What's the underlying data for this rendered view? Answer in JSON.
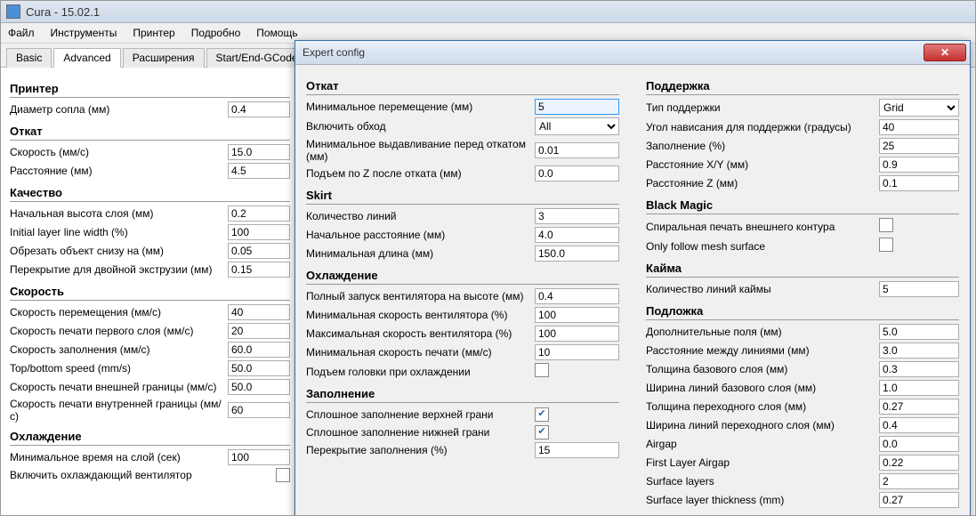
{
  "window": {
    "title": "Cura - 15.02.1"
  },
  "menu": {
    "file": "Файл",
    "tools": "Инструменты",
    "printer": "Принтер",
    "details": "Подробно",
    "help": "Помощь"
  },
  "tabs": {
    "basic": "Basic",
    "advanced": "Advanced",
    "extensions": "Расширения",
    "startend": "Start/End-GCode"
  },
  "left": {
    "printer_h": "Принтер",
    "nozzle_d": "Диаметр сопла (мм)",
    "nozzle_d_v": "0.4",
    "retract_h": "Откат",
    "speed": "Скорость (мм/с)",
    "speed_v": "15.0",
    "dist": "Расстояние (мм)",
    "dist_v": "4.5",
    "quality_h": "Качество",
    "init_layer_h": "Начальная высота слоя (мм)",
    "init_layer_h_v": "0.2",
    "init_line_w": "Initial layer line width (%)",
    "init_line_w_v": "100",
    "cut_bottom": "Обрезать объект снизу на (мм)",
    "cut_bottom_v": "0.05",
    "dual_overlap": "Перекрытие для двойной экструзии (мм)",
    "dual_overlap_v": "0.15",
    "speed_h": "Скорость",
    "travel_sp": "Скорость перемещения (мм/с)",
    "travel_sp_v": "40",
    "first_sp": "Скорость печати первого слоя (мм/с)",
    "first_sp_v": "20",
    "infill_sp": "Скорость заполнения (мм/с)",
    "infill_sp_v": "60.0",
    "tb_sp": "Top/bottom speed (mm/s)",
    "tb_sp_v": "50.0",
    "outer_sp": "Скорость печати внешней границы (мм/с)",
    "outer_sp_v": "50.0",
    "inner_sp": "Скорость печати внутренней границы (мм/с)",
    "inner_sp_v": "60",
    "cool_h": "Охлаждение",
    "min_layer_t": "Минимальное время на слой (сек)",
    "min_layer_t_v": "100",
    "fan_enable": "Включить охлаждающий вентилятор"
  },
  "dlg": {
    "title": "Expert config",
    "retract_h": "Откат",
    "min_travel": "Минимальное перемещение (мм)",
    "min_travel_v": "5",
    "combing": "Включить обход",
    "combing_v": "All",
    "min_ext": "Минимальное выдавливание перед откатом (мм)",
    "min_ext_v": "0.01",
    "z_hop": "Подъем по Z после отката (мм)",
    "z_hop_v": "0.0",
    "skirt_h": "Skirt",
    "line_cnt": "Количество линий",
    "line_cnt_v": "3",
    "start_dist": "Начальное расстояние (мм)",
    "start_dist_v": "4.0",
    "min_len": "Минимальная длина (мм)",
    "min_len_v": "150.0",
    "cool_h": "Охлаждение",
    "fan_full": "Полный запуск вентилятора на высоте (мм)",
    "fan_full_v": "0.4",
    "fan_min": "Минимальная скорость вентилятора (%)",
    "fan_min_v": "100",
    "fan_max": "Максимальная скорость вентилятора (%)",
    "fan_max_v": "100",
    "min_sp": "Минимальная скорость печати (мм/с)",
    "min_sp_v": "10",
    "head_lift": "Подъем головки при охлаждении",
    "infill_h": "Заполнение",
    "solid_top": "Сплошное заполнение верхней грани",
    "solid_bot": "Сплошное заполнение нижней грани",
    "infill_ov": "Перекрытие заполнения (%)",
    "infill_ov_v": "15",
    "support_h": "Поддержка",
    "sup_type": "Тип поддержки",
    "sup_type_v": "Grid",
    "sup_angle": "Угол нависания для поддержки (градусы)",
    "sup_angle_v": "40",
    "sup_fill": "Заполнение (%)",
    "sup_fill_v": "25",
    "sup_xy": "Расстояние X/Y (мм)",
    "sup_xy_v": "0.9",
    "sup_z": "Расстояние Z (мм)",
    "sup_z_v": "0.1",
    "bm_h": "Black Magic",
    "spiral": "Спиральная печать внешнего контура",
    "mesh": "Only follow mesh surface",
    "brim_h": "Кайма",
    "brim_cnt": "Количество линий каймы",
    "brim_cnt_v": "5",
    "raft_h": "Подложка",
    "raft_margin": "Дополнительные поля (мм)",
    "raft_margin_v": "5.0",
    "raft_linesp": "Расстояние между линиями (мм)",
    "raft_linesp_v": "3.0",
    "raft_base_t": "Толщина базового слоя (мм)",
    "raft_base_t_v": "0.3",
    "raft_base_w": "Ширина линий базового слоя (мм)",
    "raft_base_w_v": "1.0",
    "raft_if_t": "Толщина переходного слоя (мм)",
    "raft_if_t_v": "0.27",
    "raft_if_w": "Ширина линий переходного слоя (мм)",
    "raft_if_w_v": "0.4",
    "airgap": "Airgap",
    "airgap_v": "0.0",
    "fl_airgap": "First Layer Airgap",
    "fl_airgap_v": "0.22",
    "surf_layers": "Surface layers",
    "surf_layers_v": "2",
    "surf_thick": "Surface layer thickness (mm)",
    "surf_thick_v": "0.27"
  }
}
